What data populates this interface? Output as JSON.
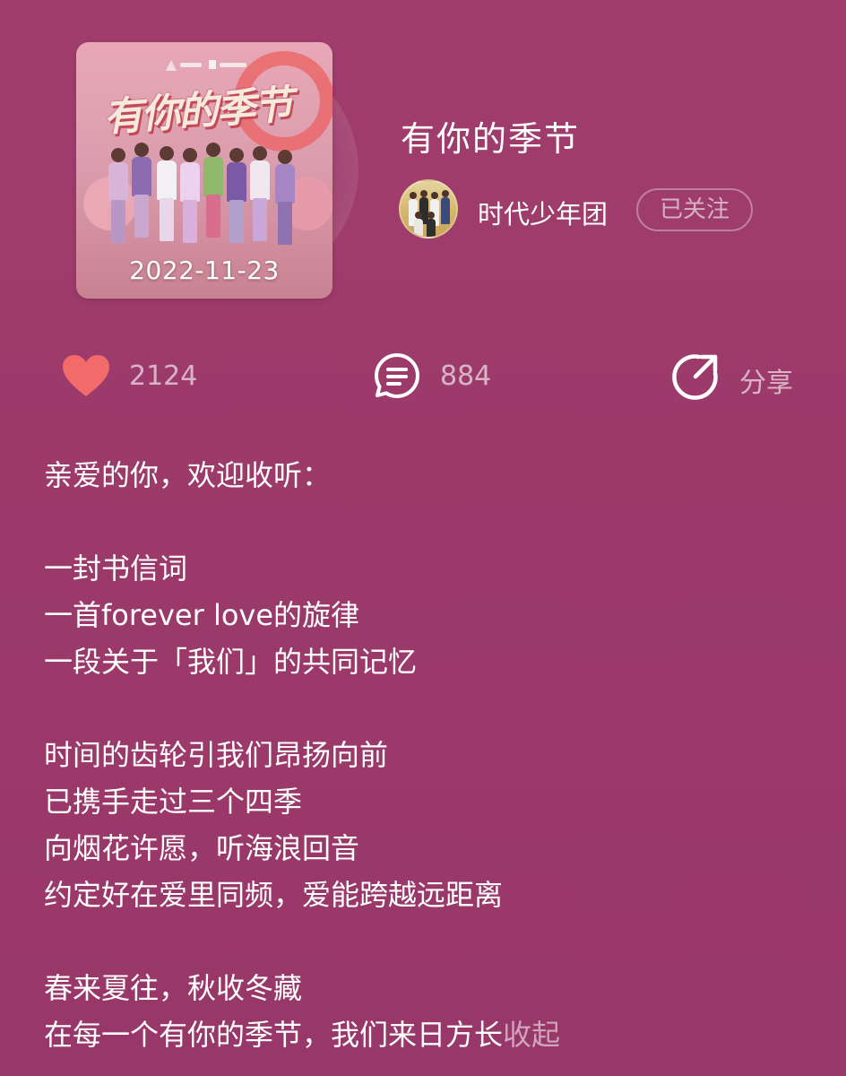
{
  "album": {
    "release_date": "2022-11-23",
    "cover_title": "有你的季节"
  },
  "song": {
    "title": "有你的季节"
  },
  "artist": {
    "name": "时代少年团",
    "follow_label": "已关注"
  },
  "actions": {
    "like_count": "2124",
    "comment_count": "884",
    "share_label": "分享",
    "like_color": "#f26a6a"
  },
  "description": {
    "lines": [
      "亲爱的你，欢迎收听：",
      "",
      "一封书信词",
      "一首forever love的旋律",
      "一段关于「我们」的共同记忆",
      "",
      "时间的齿轮引我们昂扬向前",
      "已携手走过三个四季",
      "向烟花许愿，听海浪回音",
      "约定好在爱里同频，爱能跨越远距离",
      "",
      "春来夏往，秋收冬藏",
      "在每一个有你的季节，我们来日方长"
    ],
    "collapse_label": "收起"
  },
  "colors": {
    "background": "#9c3a6a",
    "accent_heart": "#f26a6a"
  }
}
